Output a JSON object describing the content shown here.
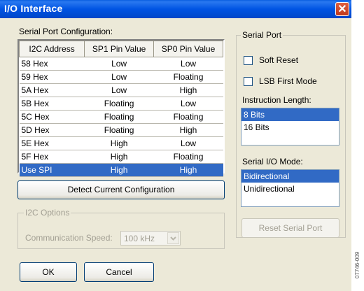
{
  "window": {
    "title": "I/O Interface",
    "close_glyph": "✕"
  },
  "serial_port_config": {
    "group_label": "Serial Port Configuration:",
    "columns": [
      "I2C Address",
      "SP1 Pin Value",
      "SP0 Pin Value"
    ],
    "rows": [
      [
        "58 Hex",
        "Low",
        "Low"
      ],
      [
        "59 Hex",
        "Low",
        "Floating"
      ],
      [
        "5A Hex",
        "Low",
        "High"
      ],
      [
        "5B Hex",
        "Floating",
        "Low"
      ],
      [
        "5C Hex",
        "Floating",
        "Floating"
      ],
      [
        "5D Hex",
        "Floating",
        "High"
      ],
      [
        "5E Hex",
        "High",
        "Low"
      ],
      [
        "5F Hex",
        "High",
        "Floating"
      ],
      [
        "Use SPI",
        "High",
        "High"
      ]
    ],
    "selected_row": "Use SPI"
  },
  "detect_button": "Detect Current Configuration",
  "i2c_options": {
    "title": "I2C Options",
    "speed_label": "Communication Speed:",
    "speed_value": "100 kHz"
  },
  "buttons": {
    "ok": "OK",
    "cancel": "Cancel"
  },
  "serial_port": {
    "title": "Serial Port",
    "soft_reset": "Soft Reset",
    "lsb_first": "LSB First Mode",
    "instruction_length_label": "Instruction Length:",
    "instruction_length_options": [
      "8 Bits",
      "16 Bits"
    ],
    "instruction_length_selected": "8 Bits",
    "io_mode_label": "Serial I/O Mode:",
    "io_mode_options": [
      "Bidirectional",
      "Unidirectional"
    ],
    "io_mode_selected": "Bidirectional",
    "reset_button": "Reset Serial Port"
  },
  "figure_id": "07746-009",
  "colors": {
    "titlebar": "#0054e3",
    "selection": "#316ac5",
    "dialog_bg": "#ece9d8"
  }
}
